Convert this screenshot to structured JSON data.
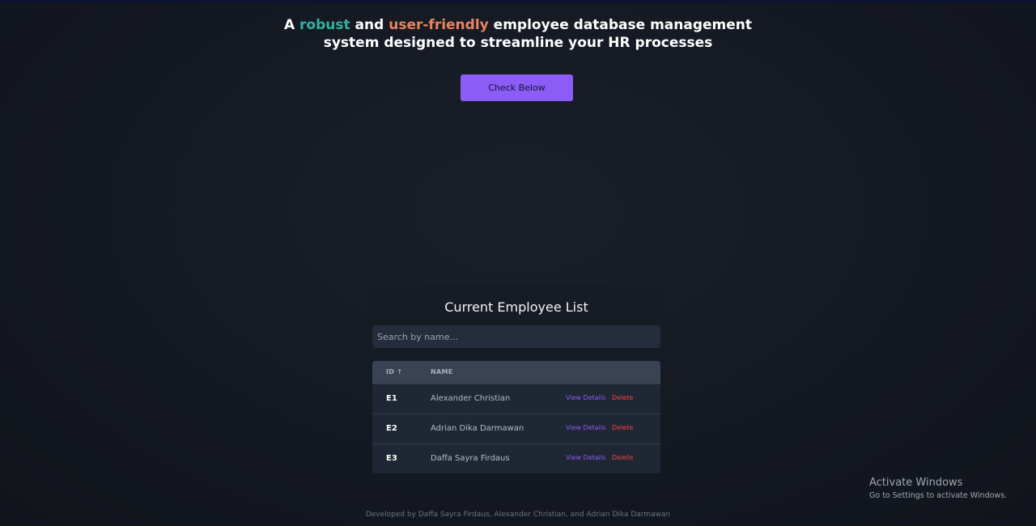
{
  "hero": {
    "headline_prefix": "A ",
    "accent_1": "robust",
    "joiner": " and ",
    "accent_2": "user-friendly",
    "headline_rest_line1": " employee database management",
    "headline_line2": "system designed to streamline your HR processes",
    "cta_label": "Check Below"
  },
  "employee_list": {
    "title": "Current Employee List",
    "search_placeholder": "Search by name...",
    "columns": {
      "id": "ID ↑",
      "name": "NAME"
    },
    "view_label": "View Details",
    "delete_label": "Delete",
    "rows": [
      {
        "id": "E1",
        "name": "Alexander Christian"
      },
      {
        "id": "E2",
        "name": "Adrian Dika Darmawan"
      },
      {
        "id": "E3",
        "name": "Daffa Sayra Firdaus"
      }
    ]
  },
  "footer": {
    "credits": "Developed by Daffa Sayra Firdaus, Alexander Christian, and Adrian Dika Darmawan"
  },
  "windows_watermark": {
    "title": "Activate Windows",
    "subtitle": "Go to Settings to activate Windows."
  },
  "colors": {
    "background": "#151a23",
    "accent_purple": "#8b5cf6",
    "accent_teal": "#2bb5a0",
    "accent_orange": "#e8845f",
    "danger_red": "#ef4444"
  }
}
